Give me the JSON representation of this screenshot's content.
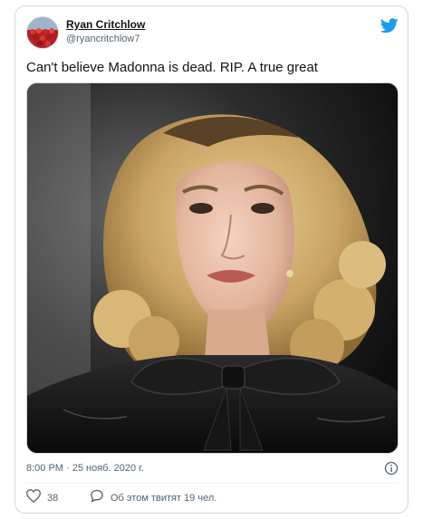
{
  "tweet": {
    "author": {
      "display_name": "Ryan Critchlow",
      "handle": "@ryancritchlow7",
      "avatar_icon": "crowd-photo-avatar"
    },
    "text": "Can't believe Madonna is dead. RIP. A true great",
    "media": {
      "icon": "portrait-photo"
    },
    "timestamp": "8:00 PM · 25 нояб. 2020 г.",
    "info_icon": "info-icon",
    "brand_icon": "twitter-bird-icon",
    "actions": {
      "likes": "38",
      "reply_label": "Об этом твитят 19 чел."
    }
  },
  "colors": {
    "brand": "#1d9bf0",
    "text_primary": "#0f1419",
    "text_secondary": "#536471",
    "border": "#cfd9de"
  }
}
